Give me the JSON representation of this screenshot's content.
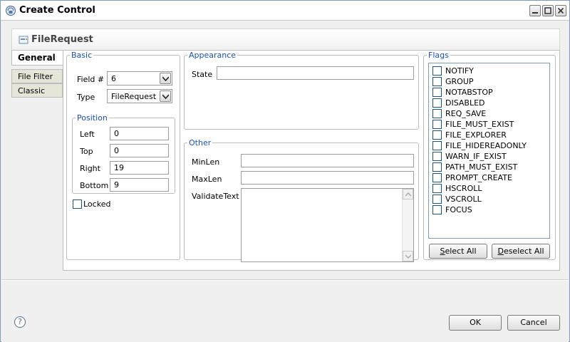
{
  "window": {
    "title": "Create Control"
  },
  "panel": {
    "title": "FileRequest"
  },
  "tabs": [
    {
      "label": "General"
    },
    {
      "label": "File Filter"
    },
    {
      "label": "Classic"
    }
  ],
  "basic": {
    "legend": "Basic",
    "field_label": "Field #",
    "field_value": "6",
    "type_label": "Type",
    "type_value": "FileRequest"
  },
  "position": {
    "legend": "Position",
    "left_label": "Left",
    "left_value": "0",
    "top_label": "Top",
    "top_value": "0",
    "right_label": "Right",
    "right_value": "19",
    "bottom_label": "Bottom",
    "bottom_value": "9"
  },
  "locked_label": "Locked",
  "appearance": {
    "legend": "Appearance",
    "state_label": "State",
    "state_value": ""
  },
  "other": {
    "legend": "Other",
    "minlen_label": "MinLen",
    "minlen_value": "",
    "maxlen_label": "MaxLen",
    "maxlen_value": "",
    "validate_label": "ValidateText",
    "validate_value": ""
  },
  "flags": {
    "legend": "Flags",
    "items": [
      {
        "label": "NOTIFY",
        "checked": false
      },
      {
        "label": "GROUP",
        "checked": false
      },
      {
        "label": "NOTABSTOP",
        "checked": false
      },
      {
        "label": "DISABLED",
        "checked": false
      },
      {
        "label": "REQ_SAVE",
        "checked": false
      },
      {
        "label": "FILE_MUST_EXIST",
        "checked": false
      },
      {
        "label": "FILE_EXPLORER",
        "checked": false
      },
      {
        "label": "FILE_HIDEREADONLY",
        "checked": false
      },
      {
        "label": "WARN_IF_EXIST",
        "checked": false
      },
      {
        "label": "PATH_MUST_EXIST",
        "checked": false
      },
      {
        "label": "PROMPT_CREATE",
        "checked": false
      },
      {
        "label": "HSCROLL",
        "checked": false
      },
      {
        "label": "VSCROLL",
        "checked": false
      },
      {
        "label": "FOCUS",
        "checked": false
      }
    ],
    "select_all_mnemonic": "S",
    "select_all_rest": "elect All",
    "deselect_all_mnemonic": "D",
    "deselect_all_rest": "eselect All"
  },
  "buttons": {
    "ok": "OK",
    "cancel": "Cancel"
  },
  "help_glyph": "?"
}
